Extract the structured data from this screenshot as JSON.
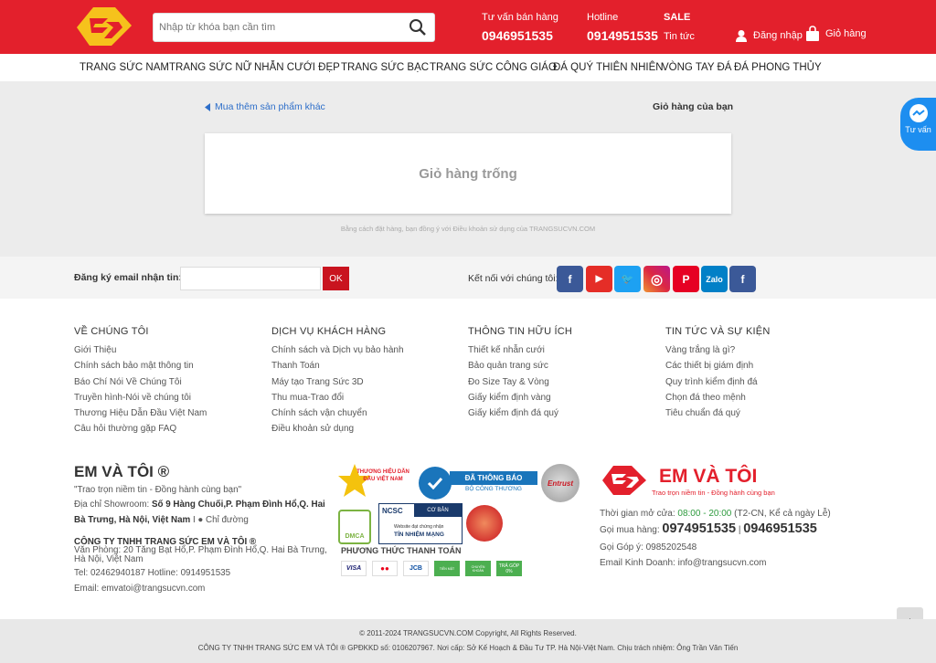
{
  "header": {
    "search_placeholder": "Nhập từ khóa bạn cần tìm",
    "advice_label": "Tư vấn bán hàng",
    "advice_phone": "0946951535",
    "hotline_label": "Hotline",
    "hotline_phone": "0914951535",
    "sale_label": "SALE",
    "news_label": "Tin tức",
    "login_label": "Đăng nhập",
    "cart_label": "Giỏ hàng"
  },
  "nav": [
    "TRANG SỨC NAM",
    "TRANG SỨC NỮ",
    "NHẪN CƯỚI ĐẸP",
    "TRANG SỨC BẠC",
    "TRANG SỨC CÔNG GIÁO",
    "ĐÁ QUÝ THIÊN NHIÊN",
    "VÒNG TAY ĐÁ",
    "ĐÁ PHONG THỦY"
  ],
  "cart": {
    "back_link": "Mua thêm sản phẩm khác",
    "title": "Giỏ hàng của bạn",
    "empty": "Giỏ hàng trống",
    "terms": "Bằng cách đặt hàng, bạn đồng ý với Điều khoản sử dụng của TRANGSUCVN.COM"
  },
  "newsletter": {
    "label": "Đăng ký email nhận tin:",
    "ok": "OK",
    "connect": "Kết nối với chúng tôi:"
  },
  "social": [
    "f",
    "▶",
    "🐦",
    "◎",
    "P",
    "Zalo",
    "f"
  ],
  "footer": {
    "col1": {
      "title": "VỀ CHÚNG TÔI",
      "links": [
        "Giới Thiệu",
        "Chính sách bảo mật thông tin",
        "Báo Chí Nói Về Chúng Tôi",
        "Truyền hình-Nói về chúng tôi",
        "Thương Hiệu Dẫn Đầu Việt Nam",
        "Câu hỏi thường gặp FAQ"
      ]
    },
    "col2": {
      "title": "DỊCH VỤ KHÁCH HÀNG",
      "links": [
        "Chính sách và Dịch vụ bảo hành",
        "Thanh Toán",
        "Máy tạo Trang Sức 3D",
        "Thu mua-Trao đổi",
        "Chính sách vận chuyển",
        "Điều khoản sử dụng"
      ]
    },
    "col3": {
      "title": "THÔNG TIN HỮU ÍCH",
      "links": [
        "Thiết kế nhẫn cưới",
        "Bảo quản trang sức",
        "Đo Size Tay & Vòng",
        "Giấy kiểm định vàng",
        "Giấy kiểm định đá quý"
      ]
    },
    "col4": {
      "title": "TIN TỨC VÀ SỰ KIỆN",
      "links": [
        "Vàng trắng là gì?",
        "Các thiết bị giám định",
        "Quy trình kiểm định đá",
        "Chọn đá theo mệnh",
        "Tiêu chuẩn đá quý"
      ]
    },
    "brand": "EM VÀ TÔI ®",
    "slogan": "\"Trao trọn niềm tin - Đồng hành cùng bạn\"",
    "showroom_label": "Địa chỉ Showroom:",
    "showroom_addr1": "Số 9 Hàng Chuối,P. Phạm Đình Hổ,Q. Hai",
    "showroom_addr2": "Bà Trưng, Hà Nội, Việt Nam",
    "directions": "I ● Chỉ đường",
    "company": "CÔNG TY TNHH TRANG SỨC EM VÀ TÔI ®",
    "office1": "Văn Phòng: 20 Tăng Bạt Hổ,P. Phạm Đình Hổ,Q. Hai Bà Trưng,",
    "office2": "Hà Nội, Việt Nam",
    "tel": "Tel: 02462940187 Hotline: 0914951535",
    "email": "Email: emvatoi@trangsucvn.com",
    "payment_label": "PHƯƠNG THỨC THANH TOÁN",
    "badges": {
      "thuonghieu": "THƯƠNG HIỆU DẪN ĐẦU VIỆT NAM",
      "dathongbao": "ĐÃ THÔNG BÁO",
      "bct": "BỘ CÔNG THƯƠNG",
      "entrust": "Entrust",
      "dmca": "DMCA",
      "ncsc": "NCSC",
      "coban": "CƠ BẢN",
      "website": "Website đạt chứng nhận",
      "tinnhiem": "TÍN NHIỆM MẠNG"
    },
    "payments": [
      "VISA",
      "●●",
      "JCB",
      "TIỀN MẶT",
      "CHUYỂN KHOẢN",
      "TRẢ GÓP 0%"
    ],
    "right_brand": "EM VÀ TÔI",
    "right_slogan": "Trao trọn niềm tin - Đồng hành cùng bạn",
    "hours_label": "Thời gian mở cửa:",
    "hours": "08:00 - 20:00",
    "hours_note": "(T2-CN, Kể cả ngày Lễ)",
    "buy_label": "Gọi mua hàng:",
    "buy_phone1": "0974951535",
    "buy_phone2": "0946951535",
    "feedback": "Gọi Góp ý: 0985202548",
    "business_email": "Email Kinh Doanh: info@trangsucvn.com"
  },
  "bottom": {
    "copyright": "© 2011-2024 TRANGSUCVN.COM Copyright, All Rights Reserved.",
    "company_line": "CÔNG TY TNHH TRANG SỨC EM VÀ TÔI ® GPĐKKD số: 0106207967. Nơi cấp: Sở Kế Hoạch & Đầu Tư TP. Hà Nội-Việt Nam. Chịu trách nhiệm: Ông Trần Văn Tiến"
  },
  "messenger_label": "Tư vấn"
}
